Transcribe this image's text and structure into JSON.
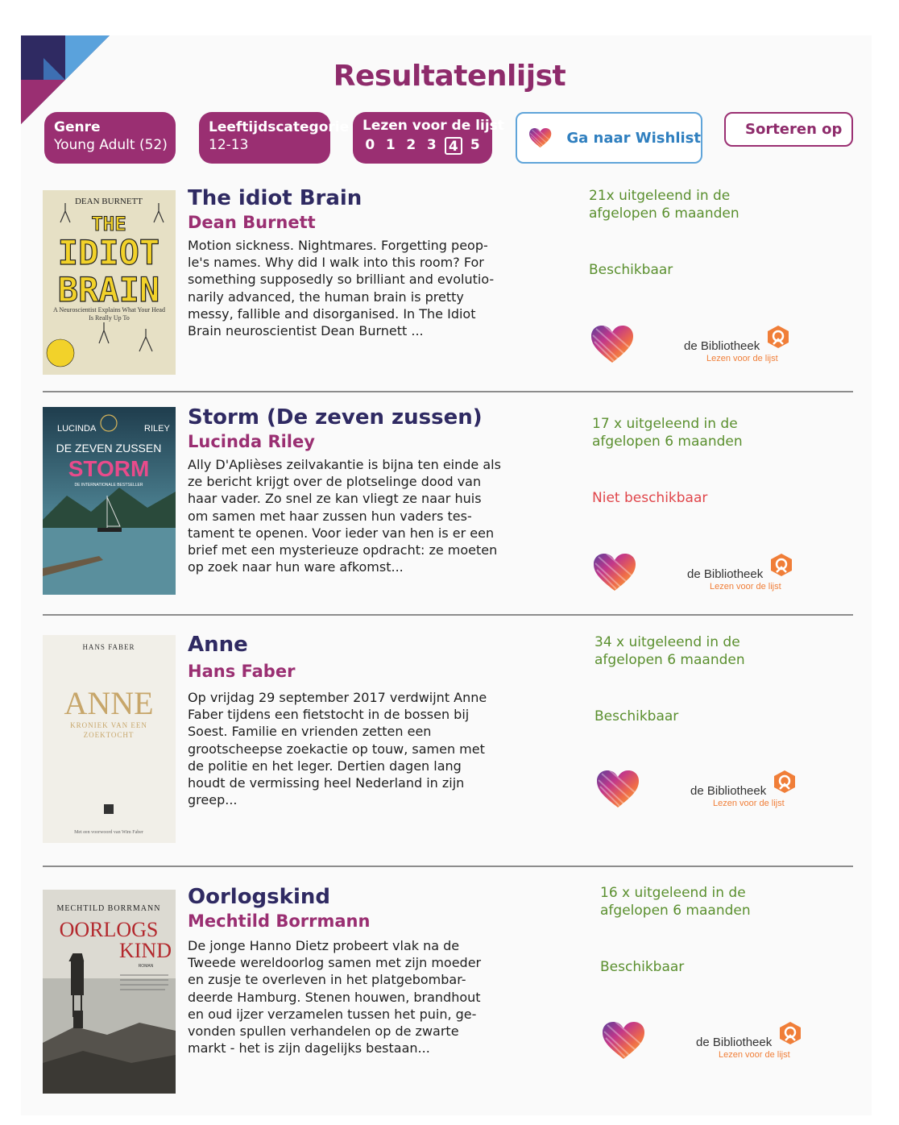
{
  "page_title": "Resultatenlijst",
  "filters": {
    "genre": {
      "label": "Genre",
      "value": "Young Adult (52)"
    },
    "age": {
      "label": "Leeftijdscategorie",
      "value": "12-13"
    },
    "level": {
      "label": "Lezen voor de lijst",
      "options": [
        "0",
        "1",
        "2",
        "3",
        "4",
        "5"
      ],
      "selected": "4"
    }
  },
  "wishlist_button": "Ga naar Wishlist",
  "sort_button": "Sorteren op",
  "library": {
    "name": "de Bibliotheek",
    "tagline": "Lezen voor de lijst"
  },
  "colors": {
    "title": "#2f2a62",
    "author": "#9a2f72",
    "available": "#5a8f2e",
    "unavailable": "#e0464b",
    "accent": "#8e2b6b"
  },
  "results": [
    {
      "title": "The idiot Brain",
      "author": "Dean Burnett",
      "description": "Motion sickness. Nightmares. Forgetting peop-le's names. Why did I walk into this room? For something supposedly so brilliant and evolutio-narily advanced, the human brain is pretty messy, fallible and disorganised. In The Idiot Brain neuroscientist Dean Burnett ...",
      "loans": "21x uitgeleend in de afgelopen 6 maanden",
      "availability": "Beschikbaar",
      "cover": {
        "author": "DEAN BURNETT",
        "title1": "THE",
        "title2": "IDIOT",
        "title3": "BRAIN",
        "subtitle": "A Neuroscientist Explains What Your Head Is Really Up To"
      }
    },
    {
      "title": "Storm (De zeven zussen)",
      "author": "Lucinda Riley",
      "description": "Ally D'Aplièses zeilvakantie is bijna ten einde als ze bericht krijgt over de plotselinge dood van haar vader. Zo snel ze kan vliegt ze naar huis om samen met haar zussen hun vaders tes-tament te openen. Voor ieder van hen is er een brief met een mysterieuze opdracht: ze moeten op zoek naar hun ware afkomst...",
      "loans": "17 x uitgeleend in de afgelopen 6 maanden",
      "availability": "Niet beschikbaar",
      "cover": {
        "author1": "LUCINDA",
        "author2": "RILEY",
        "series": "DE ZEVEN ZUSSEN",
        "title": "STORM",
        "subtitle": "DE INTERNATIONALE BESTSELLER"
      }
    },
    {
      "title": "Anne",
      "author": "Hans Faber",
      "description": "Op vrijdag 29 september 2017 verdwijnt Anne Faber tijdens een fietstocht in de bossen bij Soest. Familie en vrienden zetten een grootscheepse zoekactie op touw, samen met de politie en het leger. Dertien dagen lang houdt de vermissing heel Nederland in zijn greep...",
      "loans": "34 x uitgeleend in de afgelopen 6 maanden",
      "availability": "Beschikbaar",
      "cover": {
        "author": "HANS FABER",
        "title": "ANNE",
        "subtitle1": "KRONIEK VAN EEN",
        "subtitle2": "ZOEKTOCHT",
        "footer": "Met een voorwoord van Wim Faber"
      }
    },
    {
      "title": "Oorlogskind",
      "author": "Mechtild Borrmann",
      "description": "De jonge Hanno Dietz probeert vlak na de Tweede wereldoorlog samen met zijn moeder en zusje te overleven in het platgebombar-deerde Hamburg. Stenen houwen, brandhout en oud ijzer verzamelen tussen het puin, ge-vonden spullen verhandelen op de zwarte markt - het is zijn dagelijks bestaan...",
      "loans": "16 x uitgeleend in de afgelopen 6 maanden",
      "availability": "Beschikbaar",
      "cover": {
        "author": "MECHTILD BORRMANN",
        "title1": "OORLOGS",
        "title2": "KIND",
        "label": "ROMAN"
      }
    }
  ]
}
